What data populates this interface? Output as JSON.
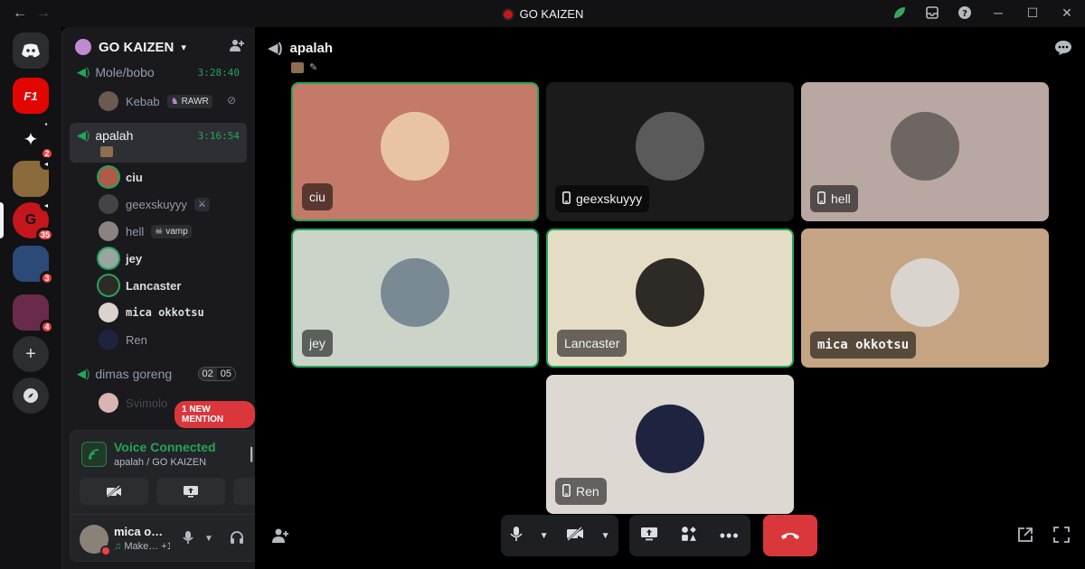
{
  "window": {
    "title": "GO KAIZEN",
    "back": "←",
    "forward": "→",
    "minimize": "─",
    "maximize": "☐",
    "close": "✕"
  },
  "rail": {
    "badges": [
      "2",
      "35",
      "3",
      "4"
    ]
  },
  "guild": {
    "name": "GO KAIZEN"
  },
  "channels": [
    {
      "name": "Mole/bobo",
      "timer": "3:28:40"
    },
    {
      "name": "apalah",
      "timer": "3:16:54"
    },
    {
      "name": "dimas goreng",
      "count_a": "02",
      "count_b": "05"
    }
  ],
  "mole_members": [
    {
      "name": "Kebab",
      "tag": "RAWR"
    }
  ],
  "apalah_members": [
    {
      "name": "ciu"
    },
    {
      "name": "geexskuyyy"
    },
    {
      "name": "hell",
      "tag": "vamp"
    },
    {
      "name": "jey"
    },
    {
      "name": "Lancaster"
    },
    {
      "name": "mica okkotsu"
    },
    {
      "name": "Ren"
    }
  ],
  "dimas_members": [
    {
      "name": "Svimolo"
    }
  ],
  "mention": "1 NEW MENTION",
  "voice": {
    "status": "Voice Connected",
    "location": "apalah / GO KAIZEN"
  },
  "user": {
    "name": "mica o…",
    "status": "Make…",
    "extra": "+1"
  },
  "main": {
    "channel": "apalah"
  },
  "tiles": [
    {
      "name": "ciu",
      "bg": "#c47a68",
      "pic": "#e8c4a0",
      "speaking": true,
      "mobile": false
    },
    {
      "name": "geexskuyyy",
      "bg": "#1b1b1b",
      "pic": "#5a5a5a",
      "speaking": false,
      "mobile": true
    },
    {
      "name": "hell",
      "bg": "#b9a7a2",
      "pic": "#6e6663",
      "speaking": false,
      "mobile": true
    },
    {
      "name": "jey",
      "bg": "#ccd4ca",
      "pic": "#7a8a94",
      "speaking": true,
      "mobile": false
    },
    {
      "name": "Lancaster",
      "bg": "#e4dcc4",
      "pic": "#2e2a26",
      "speaking": true,
      "mobile": false
    },
    {
      "name": "mica okkotsu",
      "bg": "#c4a482",
      "pic": "#d9d4ce",
      "speaking": false,
      "mobile": false
    },
    {
      "name": "Ren",
      "bg": "#ddd8d2",
      "pic": "#1e2440",
      "speaking": false,
      "mobile": true
    }
  ]
}
